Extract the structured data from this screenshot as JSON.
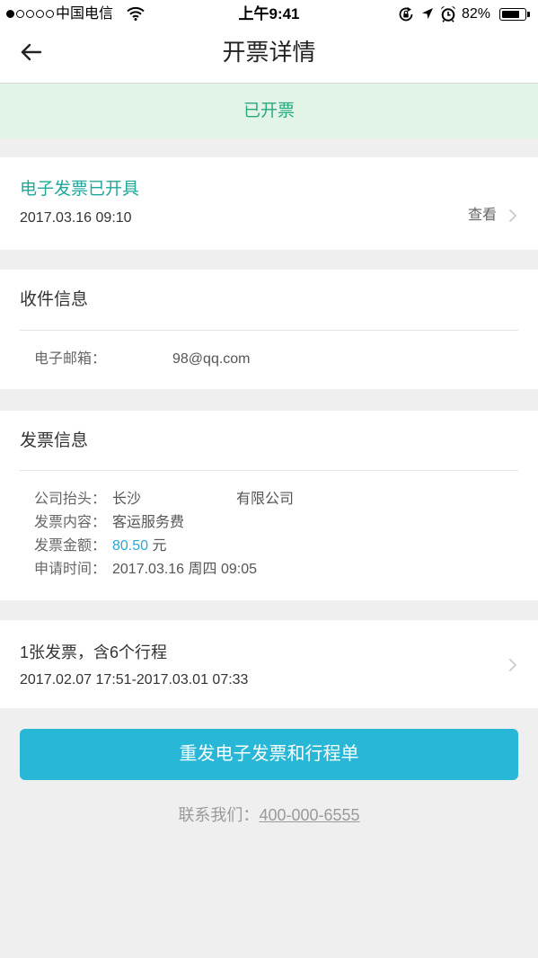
{
  "status_bar": {
    "signal": {
      "filled": 1,
      "total": 5
    },
    "carrier": "中国电信",
    "time": "上午9:41",
    "battery": "82%",
    "icons": {
      "wifi": "wifi-icon",
      "rotation_lock": "rotation-lock-icon",
      "location": "location-arrow-icon",
      "alarm": "alarm-clock-icon",
      "battery": "battery-icon"
    }
  },
  "nav": {
    "title": "开票详情",
    "back_icon": "back-arrow-icon"
  },
  "banner": {
    "text": "已开票"
  },
  "e_invoice": {
    "title": "电子发票已开具",
    "datetime": "2017.03.16 09:10",
    "view_label": "查看",
    "chevron_icon": "chevron-right-icon"
  },
  "recipient": {
    "heading": "收件信息",
    "email_label": "电子邮箱：",
    "email_value": "98@qq.com"
  },
  "invoice_info": {
    "heading": "发票信息",
    "rows": [
      {
        "label": "公司抬头：",
        "value": "长沙",
        "value2": "有限公司"
      },
      {
        "label": "发票内容：",
        "value": "客运服务费"
      },
      {
        "label": "发票金额：",
        "value": "80.50",
        "unit": "元"
      },
      {
        "label": "申请时间：",
        "value": "2017.03.16 周四 09:05"
      }
    ]
  },
  "trips": {
    "summary": "1张发票，含6个行程",
    "range": "2017.02.07 17:51-2017.03.01 07:33",
    "chevron_icon": "chevron-right-icon"
  },
  "resend_button": {
    "label": "重发电子发票和行程单"
  },
  "contact": {
    "label": "联系我们：",
    "phone": "400-000-6555"
  },
  "colors": {
    "accent_teal": "#22a69a",
    "banner_bg": "#e2f4e7",
    "banner_text": "#2aa880",
    "button_bg": "#28b7d6",
    "amount": "#2aa6d6",
    "page_bg": "#efefef"
  }
}
